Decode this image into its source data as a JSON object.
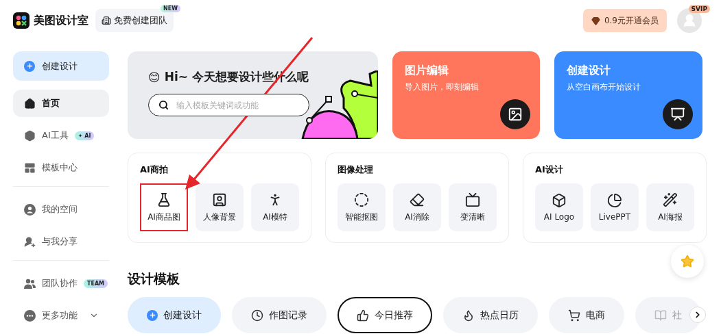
{
  "header": {
    "brand": "美图设计室",
    "team_button": {
      "label": "免费创建团队",
      "badge": "NEW"
    },
    "vip_button": "0.9元开通会员",
    "avatar_badge": "SVIP"
  },
  "sidebar": {
    "create_button": "创建设计",
    "groups": [
      [
        {
          "label": "首页",
          "selected": true
        },
        {
          "label": "AI工具",
          "selected": false,
          "badge": "✦ AI"
        },
        {
          "label": "模板中心",
          "selected": false
        }
      ],
      [
        {
          "label": "我的空间",
          "selected": false
        },
        {
          "label": "与我分享",
          "selected": false
        }
      ],
      [
        {
          "label": "团队协作",
          "selected": false,
          "badge": "TEAM"
        },
        {
          "label": "更多功能",
          "selected": false,
          "expandable": true
        }
      ]
    ]
  },
  "hero": {
    "emoji": "😊",
    "greeting": "Hi~ 今天想要设计些什么呢",
    "search": {
      "placeholder": "输入模板关键词或功能"
    }
  },
  "feature_cards": [
    {
      "title": "图片编辑",
      "subtitle": "导入图片，即刻编辑",
      "color": "#ff765c"
    },
    {
      "title": "创建设计",
      "subtitle": "从空白画布开始设计",
      "color": "#3a8bff"
    }
  ],
  "tool_panels": [
    {
      "title": "AI商拍",
      "tools": [
        {
          "label": "AI商品图",
          "highlighted": true
        },
        {
          "label": "人像背景",
          "highlighted": false
        },
        {
          "label": "AI模特",
          "highlighted": false
        }
      ]
    },
    {
      "title": "图像处理",
      "tools": [
        {
          "label": "智能抠图",
          "highlighted": false
        },
        {
          "label": "AI消除",
          "highlighted": false
        },
        {
          "label": "变清晰",
          "highlighted": false
        }
      ]
    },
    {
      "title": "AI设计",
      "tools": [
        {
          "label": "AI Logo",
          "highlighted": false
        },
        {
          "label": "LivePPT",
          "highlighted": false
        },
        {
          "label": "AI海报",
          "highlighted": false
        }
      ]
    }
  ],
  "annotation": {
    "arrow": true
  },
  "templates": {
    "title": "设计模板",
    "chips": [
      {
        "label": "创建设计",
        "selected": false,
        "kind": "create"
      },
      {
        "label": "作图记录",
        "selected": false,
        "kind": "normal"
      },
      {
        "label": "今日推荐",
        "selected": true,
        "kind": "normal"
      },
      {
        "label": "热点日历",
        "selected": false,
        "kind": "normal"
      },
      {
        "label": "电商",
        "selected": false,
        "kind": "normal"
      },
      {
        "label": "社",
        "selected": false,
        "kind": "faded"
      }
    ]
  }
}
